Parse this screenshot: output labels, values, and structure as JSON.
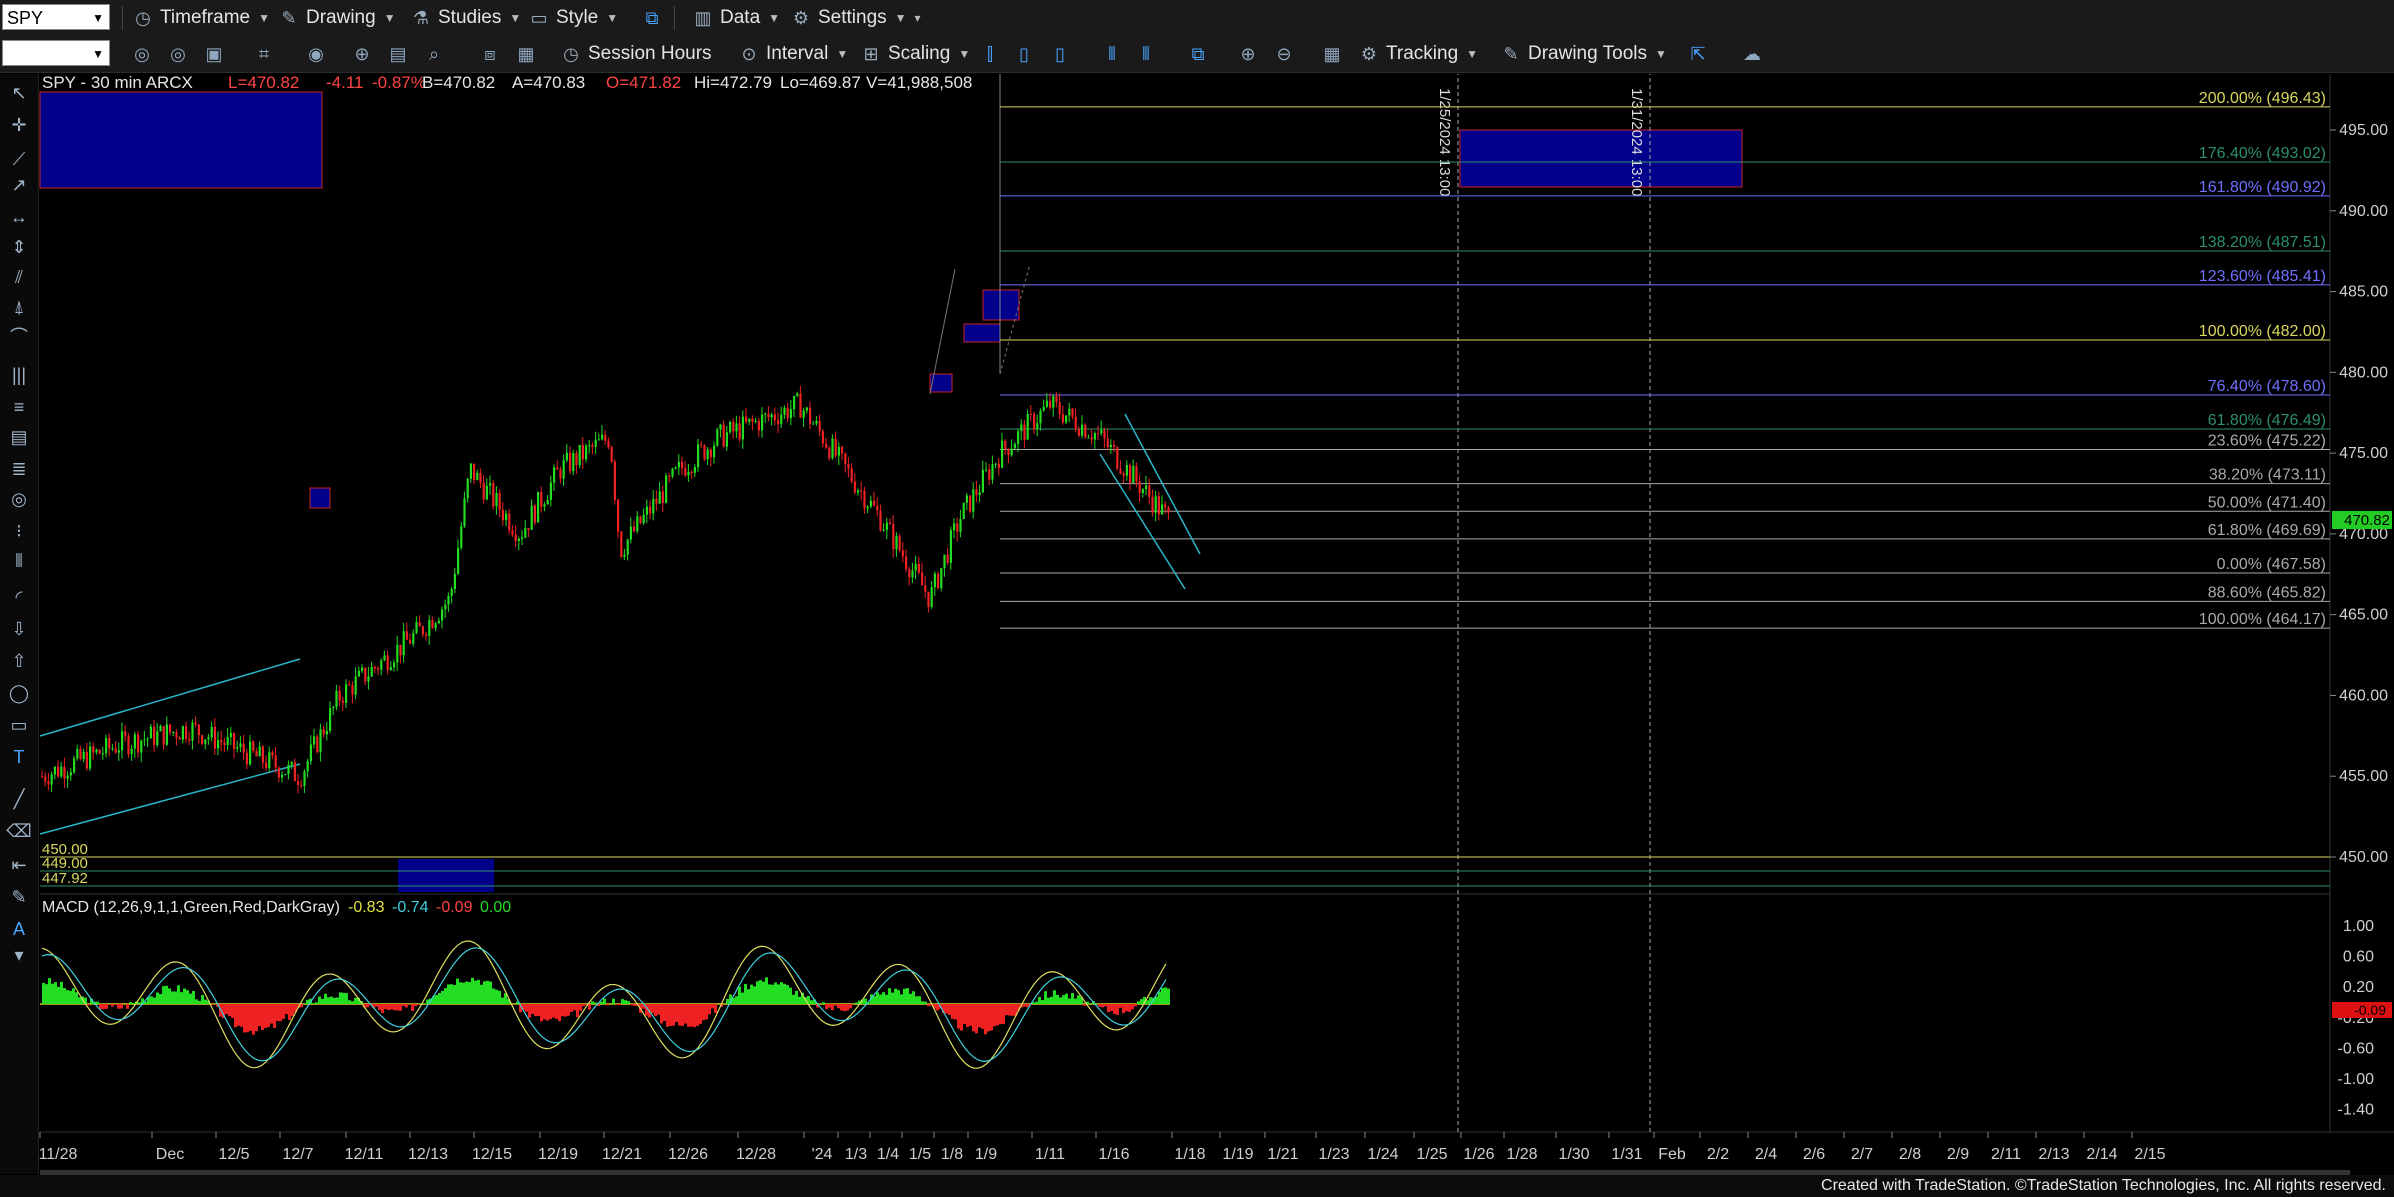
{
  "toolbar1": {
    "symbol": "SPY",
    "timeframe": "Timeframe",
    "drawing": "Drawing",
    "studies": "Studies",
    "style": "Style",
    "data": "Data",
    "settings": "Settings"
  },
  "toolbar2": {
    "session_hours": "Session Hours",
    "interval": "Interval",
    "scaling": "Scaling",
    "tracking": "Tracking",
    "drawing_tools": "Drawing Tools"
  },
  "header": {
    "symbol_info": "SPY - 30 min  ARCX",
    "last": "L=470.82",
    "change": "-4.11",
    "pct": "-0.87%",
    "bid": "B=470.82",
    "ask": "A=470.83",
    "open": "O=471.82",
    "hi": "Hi=472.79",
    "lo": "Lo=469.87",
    "vol": "V=41,988,508"
  },
  "price_axis": [
    "495.00",
    "490.00",
    "485.00",
    "480.00",
    "475.00",
    "470.00",
    "465.00",
    "460.00",
    "455.00",
    "450.00"
  ],
  "current_price": "470.82",
  "fib_levels": [
    {
      "label": "200.00% (496.43)",
      "price": 496.43,
      "color": "#d8d860"
    },
    {
      "label": "176.40% (493.02)",
      "price": 493.02,
      "color": "#2d8f6a"
    },
    {
      "label": "161.80% (490.92)",
      "price": 490.92,
      "color": "#7070ff"
    },
    {
      "label": "138.20% (487.51)",
      "price": 487.51,
      "color": "#2d8f6a"
    },
    {
      "label": "123.60% (485.41)",
      "price": 485.41,
      "color": "#7070ff"
    },
    {
      "label": "100.00% (482.00)",
      "price": 482.0,
      "color": "#d8d860"
    },
    {
      "label": "76.40% (478.60)",
      "price": 478.6,
      "color": "#7070ff"
    },
    {
      "label": "61.80% (476.49)",
      "price": 476.49,
      "color": "#2d8f6a"
    },
    {
      "label": "23.60% (475.22)",
      "price": 475.22,
      "color": "#aaaaaa"
    },
    {
      "label": "38.20% (473.11)",
      "price": 473.11,
      "color": "#aaaaaa"
    },
    {
      "label": "50.00% (471.40)",
      "price": 471.4,
      "color": "#aaaaaa"
    },
    {
      "label": "61.80% (469.69)",
      "price": 469.69,
      "color": "#aaaaaa"
    },
    {
      "label": "0.00% (467.58)",
      "price": 467.58,
      "color": "#aaaaaa"
    },
    {
      "label": "88.60% (465.82)",
      "price": 465.82,
      "color": "#aaaaaa"
    },
    {
      "label": "100.00% (464.17)",
      "price": 464.17,
      "color": "#aaaaaa"
    }
  ],
  "lower_levels": [
    "450.00",
    "449.00",
    "447.92"
  ],
  "vertical_labels": [
    "1/25/2024 13:00",
    "1/31/2024 13:00"
  ],
  "macd": {
    "title": "MACD (12,26,9,1,1,Green,Red,DarkGray)",
    "v1": "-0.83",
    "v2": "-0.74",
    "v3": "-0.09",
    "v4": "0.00",
    "axis": [
      "1.00",
      "0.60",
      "0.20",
      "-0.20",
      "-0.60",
      "-1.00",
      "-1.40"
    ],
    "current": "-0.09"
  },
  "date_axis": [
    "11/28",
    "Dec",
    "12/5",
    "12/7",
    "12/11",
    "12/13",
    "12/15",
    "12/19",
    "12/21",
    "12/26",
    "12/28",
    "'24",
    "1/3",
    "1/4",
    "1/5",
    "1/8",
    "1/9",
    "1/11",
    "1/16",
    "1/18",
    "1/19",
    "1/21",
    "1/23",
    "1/24",
    "1/25",
    "1/26",
    "1/28",
    "1/30",
    "1/31",
    "Feb",
    "2/2",
    "2/4",
    "2/6",
    "2/7",
    "2/8",
    "2/9",
    "2/11",
    "2/13",
    "2/14",
    "2/15"
  ],
  "footer": "Created with TradeStation. ©TradeStation Technologies, Inc. All rights reserved.",
  "colors": {
    "up": "#22dd22",
    "down": "#ee2222",
    "zone": "#00008b",
    "zone_border": "#cc2222",
    "channel": "#2bb5c8",
    "axis": "#cfcfcf"
  }
}
